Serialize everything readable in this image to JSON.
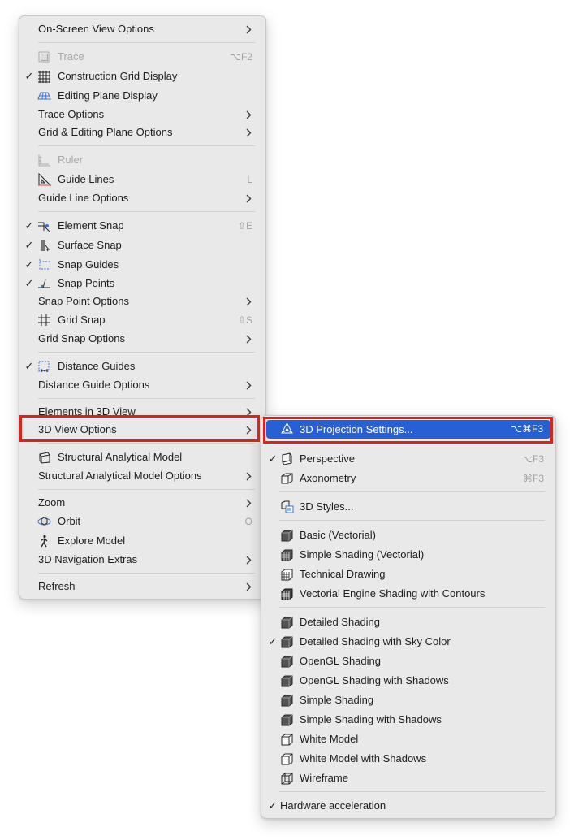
{
  "main_menu": {
    "items": [
      {
        "label": "On-Screen View Options"
      },
      {
        "label": "Trace",
        "shortcut": "⌥F2"
      },
      {
        "label": "Construction Grid Display"
      },
      {
        "label": "Editing Plane Display"
      },
      {
        "label": "Trace Options"
      },
      {
        "label": "Grid & Editing Plane Options"
      },
      {
        "label": "Ruler"
      },
      {
        "label": "Guide Lines",
        "shortcut": "L"
      },
      {
        "label": "Guide Line Options"
      },
      {
        "label": "Element Snap",
        "shortcut": "⇧E"
      },
      {
        "label": "Surface Snap"
      },
      {
        "label": "Snap Guides"
      },
      {
        "label": "Snap Points"
      },
      {
        "label": "Snap Point Options"
      },
      {
        "label": "Grid Snap",
        "shortcut": "⇧S"
      },
      {
        "label": "Grid Snap Options"
      },
      {
        "label": "Distance Guides"
      },
      {
        "label": "Distance Guide Options"
      },
      {
        "label": "Elements in 3D View"
      },
      {
        "label": "3D View Options"
      },
      {
        "label": "Structural Analytical Model"
      },
      {
        "label": "Structural Analytical Model Options"
      },
      {
        "label": "Zoom"
      },
      {
        "label": "Orbit",
        "shortcut": "O"
      },
      {
        "label": "Explore Model"
      },
      {
        "label": "3D Navigation Extras"
      },
      {
        "label": "Refresh"
      }
    ]
  },
  "sub_menu": {
    "items": [
      {
        "label": "3D Projection Settings...",
        "shortcut": "⌥⌘F3"
      },
      {
        "label": "Perspective",
        "shortcut": "⌥F3"
      },
      {
        "label": "Axonometry",
        "shortcut": "⌘F3"
      },
      {
        "label": "3D Styles..."
      },
      {
        "label": "Basic (Vectorial)"
      },
      {
        "label": "Simple Shading (Vectorial)"
      },
      {
        "label": "Technical Drawing"
      },
      {
        "label": "Vectorial Engine Shading with Contours"
      },
      {
        "label": "Detailed Shading"
      },
      {
        "label": "Detailed Shading with Sky Color"
      },
      {
        "label": "OpenGL Shading"
      },
      {
        "label": "OpenGL Shading with Shadows"
      },
      {
        "label": "Simple Shading"
      },
      {
        "label": "Simple Shading with Shadows"
      },
      {
        "label": "White Model"
      },
      {
        "label": "White Model with Shadows"
      },
      {
        "label": "Wireframe"
      },
      {
        "label": "Hardware acceleration"
      }
    ]
  },
  "colors": {
    "highlight": "#2760d4",
    "annotation_box": "#e0211b",
    "menu_bg": "#e9e9e9"
  }
}
